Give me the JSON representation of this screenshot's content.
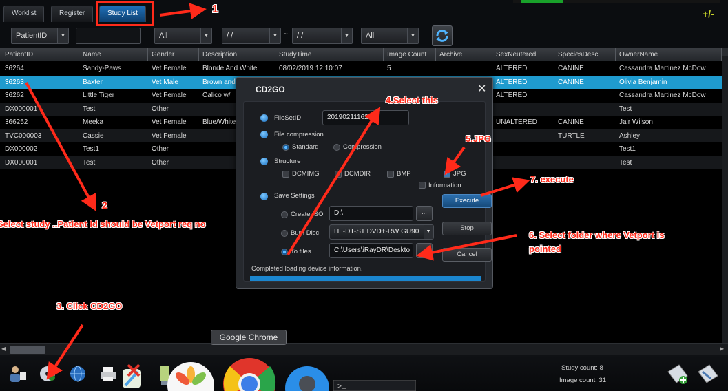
{
  "tabs": [
    {
      "label": "Worklist"
    },
    {
      "label": "Register"
    },
    {
      "label": "Study List"
    }
  ],
  "toolbar": {
    "plusminus": "+/-"
  },
  "filters": {
    "field": "PatientID",
    "value": "",
    "filter2": "All",
    "date_from": "/ /",
    "tilde": "~",
    "date_to": "/ /",
    "filter3": "All"
  },
  "grid": {
    "columns": [
      "PatientID",
      "Name",
      "Gender",
      "Description",
      "StudyTime",
      "Image Count",
      "Archive",
      "SexNeutered",
      "SpeciesDesc",
      "OwnerName"
    ],
    "rows": [
      [
        "36264",
        "Sandy-Paws",
        "Vet Female",
        "Blonde And White",
        "08/02/2019 12:10:07",
        "5",
        "",
        "ALTERED",
        "CANINE",
        "Cassandra Martinez McDow"
      ],
      [
        "36263",
        "Baxter",
        "Vet Male",
        "Brown and",
        "",
        "",
        "",
        "ALTERED",
        "CANINE",
        "Olivia Benjamin"
      ],
      [
        "36262",
        "Little Tiger",
        "Vet Female",
        "Calico w/",
        "",
        "",
        "",
        "ALTERED",
        "",
        "Cassandra Martinez McDow"
      ],
      [
        "DX000001",
        "Test",
        "Other",
        "",
        "",
        "",
        "",
        "",
        "",
        "Test"
      ],
      [
        "366252",
        "Meeka",
        "Vet Female",
        "Blue/White",
        "",
        "",
        "",
        "UNALTERED",
        "CANINE",
        "Jair Wilson"
      ],
      [
        "TVC000003",
        "Cassie",
        "Vet Female",
        "",
        "",
        "",
        "",
        "",
        "TURTLE",
        "Ashley"
      ],
      [
        "DX000002",
        "Test1",
        "Other",
        "",
        "",
        "",
        "",
        "",
        "",
        "Test1"
      ],
      [
        "DX000001",
        "Test",
        "Other",
        "",
        "",
        "",
        "",
        "",
        "",
        "Test"
      ]
    ]
  },
  "dialog": {
    "title": "CD2GO",
    "close": "✕",
    "fileset_label": "FileSetID",
    "fileset_value": "20190211162",
    "compression_label": "File compression",
    "standard": "Standard",
    "compression": "Compression",
    "structure_label": "Structure",
    "dcmimg": "DCMIMG",
    "dcmdir": "DCMDIR",
    "bmp": "BMP",
    "jpg": "JPG",
    "information": "Information",
    "save_label": "Save Settings",
    "create_iso": "Create ISO",
    "iso_path": "D:\\",
    "burn_disc": "Burn Disc",
    "drive": "HL-DT-ST DVD+-RW GU90",
    "to_files": "To files",
    "files_path": "C:\\Users\\iRayDR\\Deskto",
    "browse": "...",
    "execute": "Execute",
    "stop": "Stop",
    "cancel": "Cancel",
    "status": "Completed loading device information.",
    "progress": 1.0
  },
  "annotations": {
    "a1": "1",
    "a2": "2",
    "a2_text": "Select study ..Patient id should be Vetport req no",
    "a3": "3. Click CD2GO",
    "a4": "4.Select this",
    "a5": "5.JPG",
    "a6": "6. Select folder where Vetport is pointed",
    "a6_line1": "6. Select folder where Vetport is",
    "a6_line2": "pointed",
    "a7": "7. execute"
  },
  "tooltip": "Google Chrome",
  "footer": {
    "study_count": "Study count: 8",
    "image_count": "Image count: 31"
  },
  "colors": {
    "selected_row": "#1f9bcf",
    "annotation": "#ff2a1a",
    "accent": "#1f6fb8"
  }
}
